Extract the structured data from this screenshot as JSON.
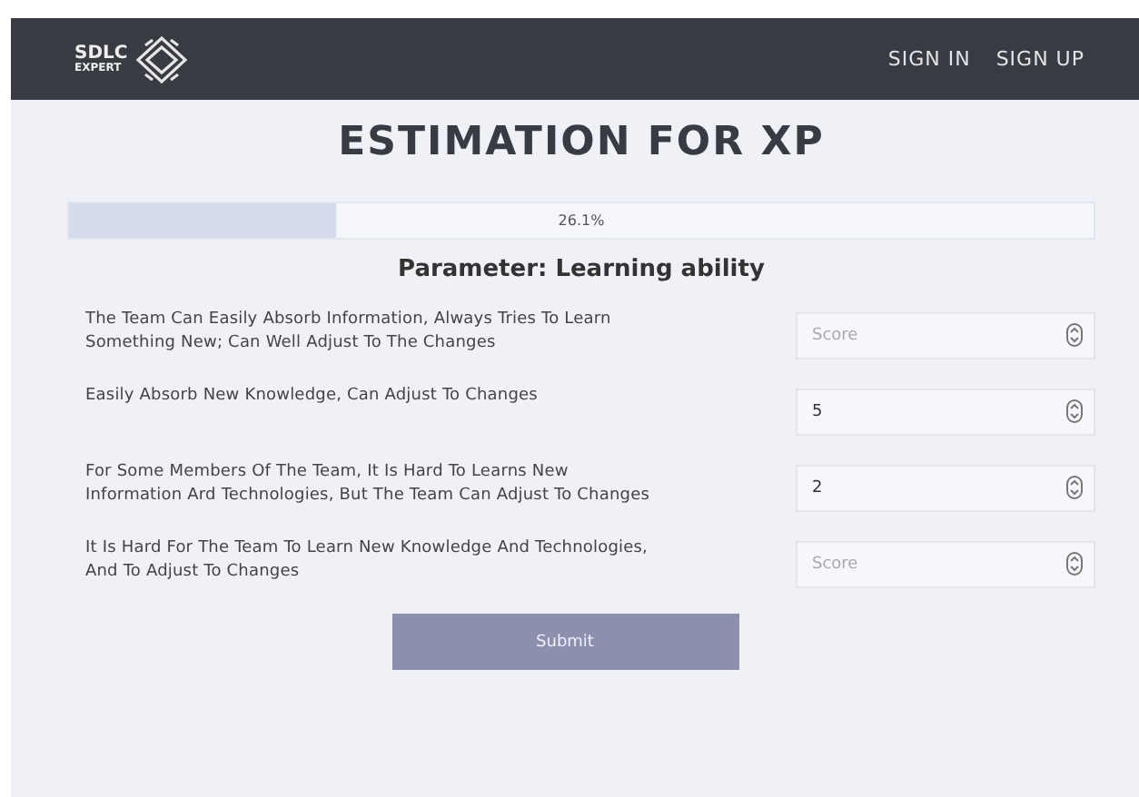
{
  "header": {
    "logo": {
      "line_1": "SDLC",
      "line_2": "EXPERT"
    },
    "links": [
      "SIGN IN",
      "SIGN UP"
    ]
  },
  "title": "ESTIMATION FOR XP",
  "progress": {
    "level": 0.261,
    "reading": "26.1%"
  },
  "parameter": "Parameter: Learning ability",
  "questions": [
    {
      "text": "The Team Can Easily Absorb Information, Always Tries To Learn Something New; Can Well Adjust To The Changes",
      "placeholder": "Score"
    },
    {
      "text": "Easily Absorb New Knowledge, Can Adjust To Changes",
      "value": "5"
    },
    {
      "text": "For Some Members Of The Team, It Is Hard To Learns New Information Ard Technologies, But The Team Can Adjust To Changes",
      "value": "2"
    },
    {
      "text": "It Is Hard For The Team To Learn New Knowledge And Technologies, And To Adjust To Changes",
      "placeholder": "Score"
    }
  ],
  "submit": "Submit"
}
